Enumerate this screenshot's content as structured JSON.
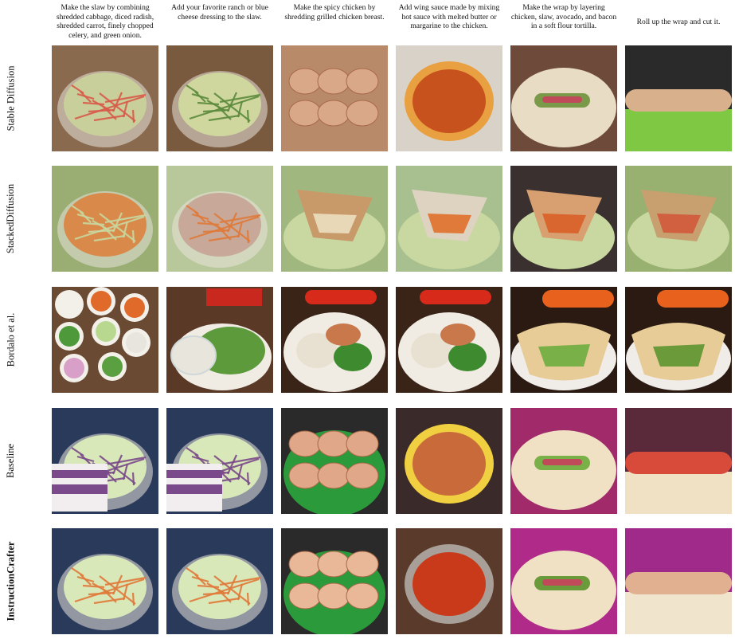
{
  "columns": [
    "Make the slaw by combining shredded cabbage, diced radish, shredded carrot, finely chopped celery, and green onion.",
    "Add your favorite ranch or blue cheese dressing to the slaw.",
    "Make the spicy chicken by shredding grilled chicken breast.",
    "Add wing sauce made by mixing hot sauce with melted butter or margarine to the chicken.",
    "Make the wrap by layering chicken, slaw, avocado, and bacon in a soft flour tortilla.",
    "Roll up the wrap and cut it."
  ],
  "rows": [
    {
      "label": "Stable Diffusion",
      "bold": false,
      "cells": [
        {
          "bg": "#8a6a4e",
          "main": "#c9cf9a",
          "accent": "#d85a4a",
          "subject": "bowl-of-slaw"
        },
        {
          "bg": "#7a5a3e",
          "main": "#cfd79e",
          "accent": "#5c8a3c",
          "subject": "bowl-of-slaw"
        },
        {
          "bg": "#b98a6a",
          "main": "#d9a888",
          "accent": "#a0492e",
          "subject": "chicken-pieces"
        },
        {
          "bg": "#d9d2c8",
          "main": "#c8521e",
          "accent": "#e8a040",
          "subject": "sauce-bowl"
        },
        {
          "bg": "#6e4a3a",
          "main": "#e8dcc4",
          "accent": "#7a9a4a",
          "subject": "tortilla"
        },
        {
          "bg": "#2a2a2a",
          "main": "#7ec843",
          "accent": "#d9b08c",
          "subject": "rolled-wrap"
        }
      ]
    },
    {
      "label": "StackedDiffusion",
      "bold": false,
      "cells": [
        {
          "bg": "#9aae74",
          "main": "#d98a4a",
          "accent": "#c8d8a0",
          "subject": "salad"
        },
        {
          "bg": "#b8c89a",
          "main": "#c8a898",
          "accent": "#e07a3a",
          "subject": "salad"
        },
        {
          "bg": "#a0b880",
          "main": "#c89a6a",
          "accent": "#e8d8b8",
          "subject": "wrap-on-greens"
        },
        {
          "bg": "#a8c090",
          "main": "#ded2c0",
          "accent": "#e07a3a",
          "subject": "wrap-on-greens"
        },
        {
          "bg": "#3a3030",
          "main": "#d8a070",
          "accent": "#d9662e",
          "subject": "wrap-on-greens"
        },
        {
          "bg": "#98b070",
          "main": "#c8a070",
          "accent": "#d06040",
          "subject": "wrap-on-greens"
        }
      ]
    },
    {
      "label": "Bordalo et al.",
      "bold": false,
      "cells": [
        {
          "bg": "#6a4a32",
          "main": "#e8e0d0",
          "accent": "#e06a2a",
          "subject": "ingredient-bowls"
        },
        {
          "bg": "#5a3a26",
          "main": "#5c9a3c",
          "accent": "#e8e6dc",
          "subject": "salad-with-dip"
        },
        {
          "bg": "#3a2418",
          "main": "#f0ece4",
          "accent": "#3e8a2e",
          "subject": "chicken-rice-bowl"
        },
        {
          "bg": "#3a2418",
          "main": "#f0ece4",
          "accent": "#3e8a2e",
          "subject": "chicken-rice-bowl"
        },
        {
          "bg": "#2a1a12",
          "main": "#e8cc98",
          "accent": "#7ab048",
          "subject": "burrito-plate"
        },
        {
          "bg": "#2a1a12",
          "main": "#e8cc98",
          "accent": "#6a9a3a",
          "subject": "burrito-plate"
        }
      ]
    },
    {
      "label": "Baseline",
      "bold": false,
      "cells": [
        {
          "bg": "#2a3a5a",
          "main": "#d8e8b8",
          "accent": "#7a4a8a",
          "subject": "slaw-with-package"
        },
        {
          "bg": "#2a3a5a",
          "main": "#d8e8b8",
          "accent": "#7a4a8a",
          "subject": "slaw-with-package"
        },
        {
          "bg": "#2a2a2a",
          "main": "#e0a888",
          "accent": "#2a9a3a",
          "subject": "chicken-green-bowl"
        },
        {
          "bg": "#3a2a2a",
          "main": "#c86a3a",
          "accent": "#f0d040",
          "subject": "sauce-bowl"
        },
        {
          "bg": "#a02a6a",
          "main": "#f0e0c4",
          "accent": "#7ab048",
          "subject": "tortilla"
        },
        {
          "bg": "#5a2a3a",
          "main": "#f0e0c4",
          "accent": "#d84a3a",
          "subject": "rolled-wrap"
        }
      ]
    },
    {
      "label": "InstructionCrafter",
      "bold": true,
      "cells": [
        {
          "bg": "#2a3a5a",
          "main": "#d8e8b8",
          "accent": "#e07a3a",
          "subject": "bowl-of-slaw"
        },
        {
          "bg": "#2a3a5a",
          "main": "#d8e8b8",
          "accent": "#e07a3a",
          "subject": "bowl-of-slaw"
        },
        {
          "bg": "#2a2a2a",
          "main": "#e8b898",
          "accent": "#2a9a3a",
          "subject": "chicken-green-bowl"
        },
        {
          "bg": "#5a3a2a",
          "main": "#c83a1a",
          "accent": "#a8a098",
          "subject": "sauce-bowl"
        },
        {
          "bg": "#b02a8a",
          "main": "#f0e0c4",
          "accent": "#6a9a3a",
          "subject": "tortilla"
        },
        {
          "bg": "#a02a8a",
          "main": "#f0e4cc",
          "accent": "#e0b090",
          "subject": "rolled-wrap"
        }
      ]
    }
  ]
}
